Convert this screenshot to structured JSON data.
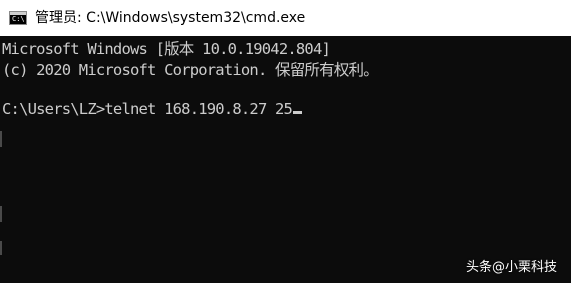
{
  "window": {
    "title": "管理员: C:\\Windows\\system32\\cmd.exe",
    "icon": "cmd-icon",
    "icon_glyph": "C:\\"
  },
  "terminal": {
    "lines": [
      "Microsoft Windows [版本 10.0.19042.804]",
      "(c) 2020 Microsoft Corporation. 保留所有权利。",
      "C:\\Users\\LZ>telnet 168.190.8.27 25"
    ]
  },
  "watermark": {
    "source": "头条",
    "separator": "@",
    "author": "小栗科技"
  },
  "colors": {
    "background": "#0c0c0c",
    "foreground": "#cccccc",
    "titlebar": "#ffffff"
  }
}
